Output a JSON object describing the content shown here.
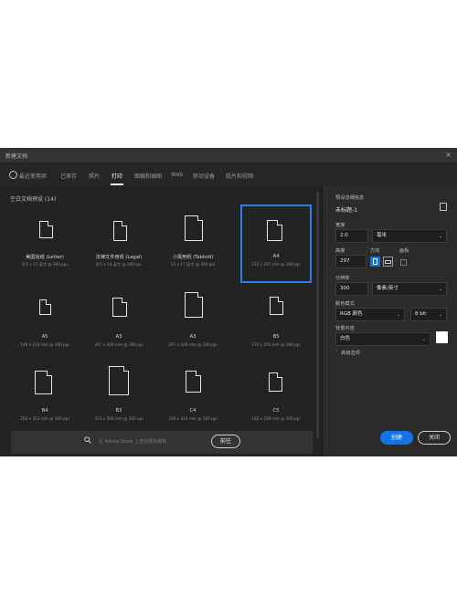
{
  "window": {
    "title": "新建文档",
    "close": "×"
  },
  "tabs": [
    {
      "label": "最近使用项"
    },
    {
      "label": "已保存"
    },
    {
      "label": "照片"
    },
    {
      "label": "打印"
    },
    {
      "label": "图稿和插图"
    },
    {
      "label": "Web"
    },
    {
      "label": "移动设备"
    },
    {
      "label": "胶片和视频"
    }
  ],
  "active_tab": "打印",
  "main": {
    "section_title": "空白文档预设 (14)",
    "presets": [
      {
        "name": "美国信纸 (Letter)",
        "size": "8.5 x 11 英寸 @ 300 ppi"
      },
      {
        "name": "法律文件用纸 (Legal)",
        "size": "8.5 x 14 英寸 @ 300 ppi"
      },
      {
        "name": "小报用纸 (Tabloid)",
        "size": "11 x 17 英寸 @ 300 ppi"
      },
      {
        "name": "A4",
        "size": "210 x 297 mm @ 300 ppi"
      },
      {
        "name": "A5",
        "size": "148 x 210 mm @ 300 ppi"
      },
      {
        "name": "A3",
        "size": "297 x 420 mm @ 300 ppi"
      },
      {
        "name": "A3",
        "size": "297 x 420 mm @ 300 ppi"
      },
      {
        "name": "B5",
        "size": "176 x 250 mm @ 300 ppi"
      },
      {
        "name": "B4",
        "size": "250 x 353 mm @ 300 ppi"
      },
      {
        "name": "B3",
        "size": "353 x 500 mm @ 300 ppi"
      },
      {
        "name": "C4",
        "size": "229 x 324 mm @ 300 ppi"
      },
      {
        "name": "C5",
        "size": "162 x 229 mm @ 300 ppi"
      }
    ],
    "selected_preset": "A4",
    "search_placeholder": "在 Adobe Stock 上查找更多模板",
    "go_button": "前往"
  },
  "panel": {
    "heading": "预设详细信息",
    "doc_name": "未标题-1",
    "width_label": "宽度",
    "width_value": "2.0",
    "width_unit": "毫米",
    "height_label": "高度",
    "height_value": "297",
    "orientation_label": "方向",
    "artboard_label": "画板",
    "resolution_label": "分辨率",
    "resolution_value": "300",
    "resolution_unit": "像素/英寸",
    "color_mode_label": "颜色模式",
    "color_mode_value": "RGB 颜色",
    "bit_depth": "8 bit",
    "background_label": "背景内容",
    "background_value": "白色",
    "advanced_label": "高级选项",
    "create_button": "创建",
    "close_button": "关闭"
  },
  "colors": {
    "accent": "#2b7de9",
    "primary_button": "#1473e6",
    "swatch": "#ffffff"
  },
  "icons": [
    "clock-icon",
    "document-icon",
    "search-icon",
    "save-preset-icon",
    "portrait-icon",
    "landscape-icon",
    "chevron-down-icon",
    "chevron-right-icon",
    "close-icon"
  ]
}
